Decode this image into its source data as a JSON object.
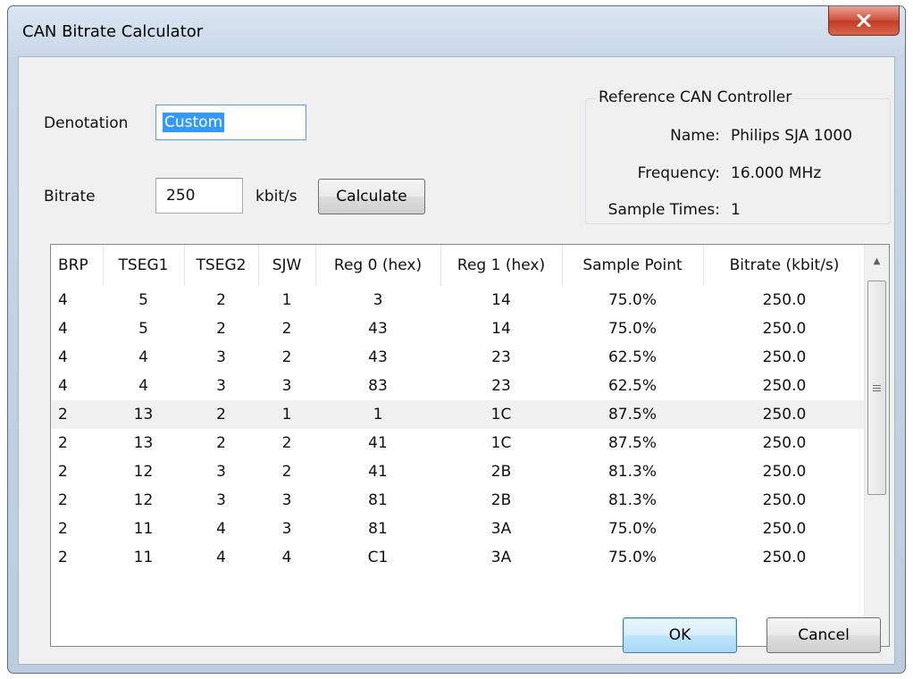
{
  "window": {
    "title": "CAN Bitrate Calculator",
    "close_label": "X"
  },
  "form": {
    "denotation_label": "Denotation",
    "denotation_value": "Custom",
    "bitrate_label": "Bitrate",
    "bitrate_value": "250",
    "bitrate_unit": "kbit/s",
    "calculate_label": "Calculate"
  },
  "controller": {
    "group_title": "Reference CAN Controller",
    "name_label": "Name:",
    "name_value": "Philips SJA 1000",
    "frequency_label": "Frequency:",
    "frequency_value": "16.000 MHz",
    "sample_times_label": "Sample Times:",
    "sample_times_value": "1"
  },
  "table": {
    "columns": [
      "BRP",
      "TSEG1",
      "TSEG2",
      "SJW",
      "Reg 0 (hex)",
      "Reg 1 (hex)",
      "Sample Point",
      "Bitrate (kbit/s)"
    ],
    "rows": [
      [
        "4",
        "5",
        "2",
        "1",
        "3",
        "14",
        "75.0%",
        "250.0"
      ],
      [
        "4",
        "5",
        "2",
        "2",
        "43",
        "14",
        "75.0%",
        "250.0"
      ],
      [
        "4",
        "4",
        "3",
        "2",
        "43",
        "23",
        "62.5%",
        "250.0"
      ],
      [
        "4",
        "4",
        "3",
        "3",
        "83",
        "23",
        "62.5%",
        "250.0"
      ],
      [
        "2",
        "13",
        "2",
        "1",
        "1",
        "1C",
        "87.5%",
        "250.0"
      ],
      [
        "2",
        "13",
        "2",
        "2",
        "41",
        "1C",
        "87.5%",
        "250.0"
      ],
      [
        "2",
        "12",
        "3",
        "2",
        "41",
        "2B",
        "81.3%",
        "250.0"
      ],
      [
        "2",
        "12",
        "3",
        "3",
        "81",
        "2B",
        "81.3%",
        "250.0"
      ],
      [
        "2",
        "11",
        "4",
        "3",
        "81",
        "3A",
        "75.0%",
        "250.0"
      ],
      [
        "2",
        "11",
        "4",
        "4",
        "C1",
        "3A",
        "75.0%",
        "250.0"
      ]
    ],
    "highlighted_row": 4
  },
  "buttons": {
    "ok_label": "OK",
    "cancel_label": "Cancel"
  }
}
